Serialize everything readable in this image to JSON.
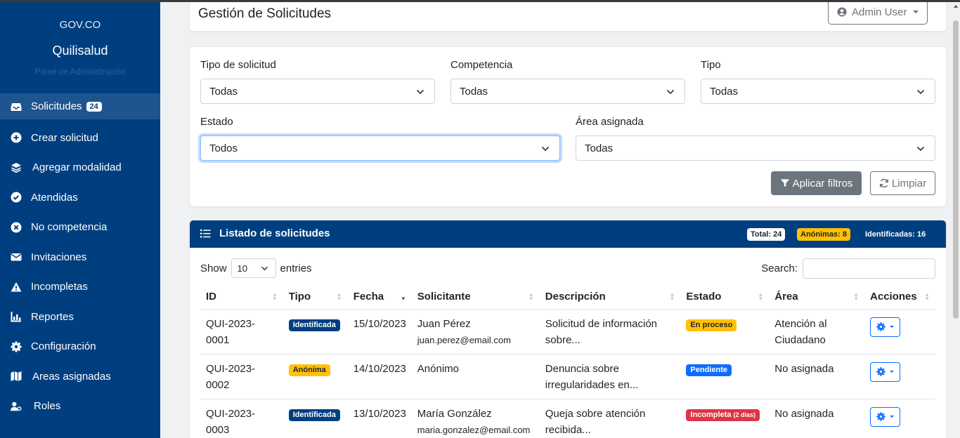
{
  "sidebar": {
    "brand_top": "GOV.CO",
    "brand_name": "Quilisalud",
    "brand_sub": "Panel de Administración",
    "items": [
      {
        "label": "Solicitudes",
        "icon": "inbox-icon",
        "badge": "24",
        "active": true
      },
      {
        "label": "Crear solicitud",
        "icon": "plus-circle-icon"
      },
      {
        "label": "Agregar modalidad",
        "icon": "layers-icon"
      },
      {
        "label": "Atendidas",
        "icon": "check-circle-icon"
      },
      {
        "label": "No competencia",
        "icon": "x-circle-icon"
      },
      {
        "label": "Invitaciones",
        "icon": "envelope-icon"
      },
      {
        "label": "Incompletas",
        "icon": "warning-icon"
      },
      {
        "label": "Reportes",
        "icon": "chart-icon"
      },
      {
        "label": "Configuración",
        "icon": "gear-icon"
      },
      {
        "label": "Areas asignadas",
        "icon": "map-icon"
      },
      {
        "label": "Roles",
        "icon": "user-gear-icon"
      }
    ]
  },
  "header": {
    "title": "Gestión de Solicitudes",
    "user_label": "Admin User",
    "user_icon": "user-circle-icon"
  },
  "filters": {
    "tipo_solicitud": {
      "label": "Tipo de solicitud",
      "value": "Todas"
    },
    "competencia": {
      "label": "Competencia",
      "value": "Todas"
    },
    "tipo": {
      "label": "Tipo",
      "value": "Todas"
    },
    "estado": {
      "label": "Estado",
      "value": "Todos"
    },
    "area": {
      "label": "Área asignada",
      "value": "Todas"
    },
    "apply_label": "Aplicar filtros",
    "clear_label": "Limpiar"
  },
  "list": {
    "title": "Listado de solicitudes",
    "total_badge": "Total: 24",
    "anon_badge": "Anónimas: 8",
    "ident_badge": "Identificadas: 16",
    "show_label": "Show",
    "entries_value": "10",
    "entries_label": "entries",
    "search_label": "Search:",
    "columns": [
      "ID",
      "Tipo",
      "Fecha",
      "Solicitante",
      "Descripción",
      "Estado",
      "Área",
      "Acciones"
    ],
    "rows": [
      {
        "id": "QUI-2023-0001",
        "tipo": "Identificada",
        "fecha": "15/10/2023",
        "solicitante": "Juan Pérez",
        "email": "juan.perez@email.com",
        "desc1": "Solicitud de información",
        "desc2": "sobre...",
        "estado": "En proceso",
        "estado_extra": "",
        "area1": "Atención al",
        "area2": "Ciudadano"
      },
      {
        "id": "QUI-2023-0002",
        "tipo": "Anónima",
        "fecha": "14/10/2023",
        "solicitante": "Anónimo",
        "email": "",
        "desc1": "Denuncia sobre",
        "desc2": "irregularidades en...",
        "estado": "Pendiente",
        "estado_extra": "",
        "area1": "No asignada",
        "area2": ""
      },
      {
        "id": "QUI-2023-0003",
        "tipo": "Identificada",
        "fecha": "13/10/2023",
        "solicitante": "María González",
        "email": "maria.gonzalez@email.com",
        "desc1": "Queja sobre atención",
        "desc2": "recibida...",
        "estado": "Incompleta",
        "estado_extra": "(2 días)",
        "area1": "No asignada",
        "area2": ""
      }
    ]
  },
  "colors": {
    "sidebar_bg": "#003f7f",
    "accent_blue": "#0d6efd",
    "warning": "#ffc107",
    "danger": "#dc3545",
    "secondary": "#6c757d"
  }
}
